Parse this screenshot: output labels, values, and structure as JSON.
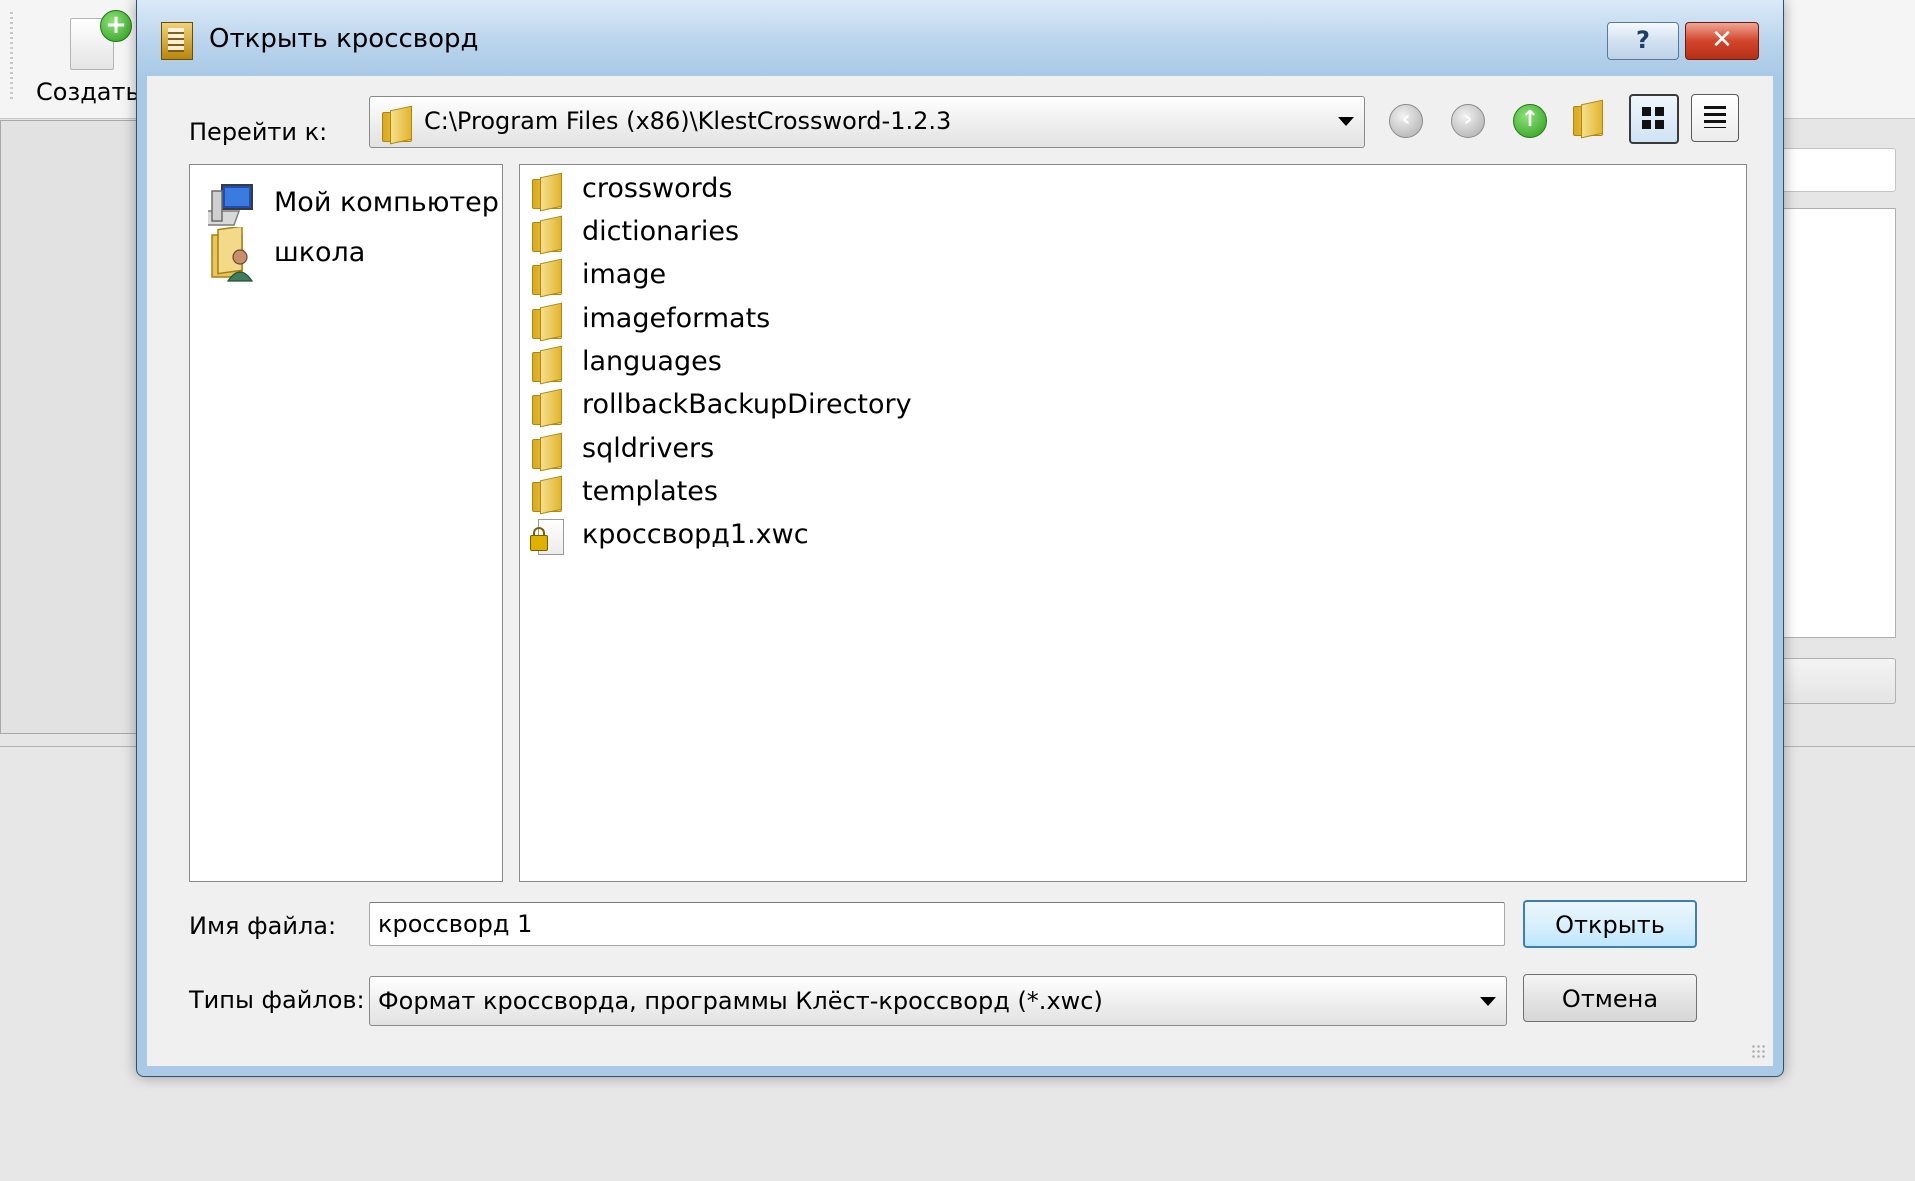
{
  "app": {
    "create_label": "Создать"
  },
  "dialog": {
    "title": "Открыть кроссворд",
    "help_glyph": "?",
    "close_glyph": "✕",
    "lookin_label": "Перейти к:",
    "lookin_path": "C:\\Program Files (x86)\\KlestCrossword-1.2.3",
    "places": [
      {
        "label": "Мой компьютер",
        "icon": "computer-icon"
      },
      {
        "label": "школа",
        "icon": "user-folder-icon"
      }
    ],
    "files": [
      {
        "name": "crosswords",
        "type": "folder"
      },
      {
        "name": "dictionaries",
        "type": "folder"
      },
      {
        "name": "image",
        "type": "folder"
      },
      {
        "name": "imageformats",
        "type": "folder"
      },
      {
        "name": "languages",
        "type": "folder"
      },
      {
        "name": "rollbackBackupDirectory",
        "type": "folder"
      },
      {
        "name": "sqldrivers",
        "type": "folder"
      },
      {
        "name": "templates",
        "type": "folder"
      },
      {
        "name": "кроссворд1.xwc",
        "type": "locked-file"
      }
    ],
    "filename_label": "Имя файла:",
    "filename_value": "кроссворд 1",
    "filetypes_label": "Типы файлов:",
    "filetypes_value": "Формат кроссворда, программы Клёст-кроссворд (*.xwc)",
    "open_button": "Открыть",
    "cancel_button": "Отмена"
  },
  "colors": {
    "frame": "#a9c9e6",
    "client": "#f0f0f0",
    "close_red": "#d2452a",
    "default_button_border": "#3c7fb1"
  }
}
